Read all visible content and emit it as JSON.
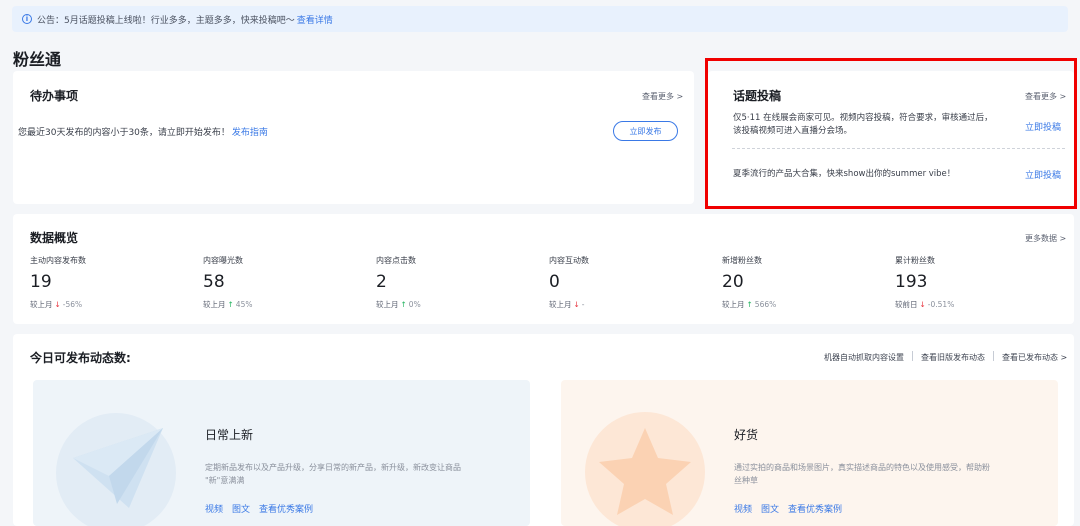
{
  "notice": {
    "text": "公告：5月话题投稿上线啦！行业多多，主题多多，快来投稿吧～",
    "link": "查看详情"
  },
  "page_title": "粉丝通",
  "todo": {
    "title": "待办事项",
    "more": "查看更多 >",
    "text": "您最近30天发布的内容小于30条，请立即开始发布！",
    "guide_link": "发布指南",
    "publish_button": "立即发布"
  },
  "topic": {
    "title": "话题投稿",
    "more": "查看更多 >",
    "items": [
      {
        "line1": "仅5·11 在线展会商家可见。视频内容投稿，符合要求，审核通过后，",
        "line2": "该投稿视频可进入直播分会场。",
        "action": "立即投稿"
      },
      {
        "line1": "夏季流行的产品大合集，快来show出你的summer vibe！",
        "line2": "",
        "action": "立即投稿"
      }
    ]
  },
  "overview": {
    "title": "数据概览",
    "more": "更多数据 >",
    "stats": [
      {
        "label": "主动内容发布数",
        "value": "19",
        "compare": "较上月",
        "trend": "down",
        "pct": "-56%"
      },
      {
        "label": "内容曝光数",
        "value": "58",
        "compare": "较上月",
        "trend": "up",
        "pct": "45%"
      },
      {
        "label": "内容点击数",
        "value": "2",
        "compare": "较上月",
        "trend": "up",
        "pct": "0%"
      },
      {
        "label": "内容互动数",
        "value": "0",
        "compare": "较上月",
        "trend": "down",
        "pct": "-"
      },
      {
        "label": "新增粉丝数",
        "value": "20",
        "compare": "较上月",
        "trend": "up",
        "pct": "566%"
      },
      {
        "label": "累计粉丝数",
        "value": "193",
        "compare": "较前日",
        "trend": "down",
        "pct": "-0.51%"
      }
    ]
  },
  "today": {
    "title": "今日可发布动态数:",
    "links": [
      "机器自动抓取内容设置",
      "查看旧版发布动态",
      "查看已发布动态 >"
    ],
    "panels": [
      {
        "title": "日常上新",
        "desc1": "定期新品发布以及产品升级，分享日常的新产品，新升级，新改变让商品",
        "desc2": "\"新\"意满满",
        "links": [
          "视频",
          "图文",
          "查看优秀案例"
        ],
        "icon": "paper-plane-icon"
      },
      {
        "title": "好货",
        "desc1": "通过实拍的商品和场景图片，真实描述商品的特色以及使用感受，帮助粉",
        "desc2": "丝种草",
        "links": [
          "视频",
          "图文",
          "查看优秀案例"
        ],
        "icon": "star-icon"
      }
    ]
  },
  "colors": {
    "accent": "#3a79e6",
    "up": "#22b35e",
    "down": "#e8353f",
    "highlight_frame": "#f00000"
  }
}
